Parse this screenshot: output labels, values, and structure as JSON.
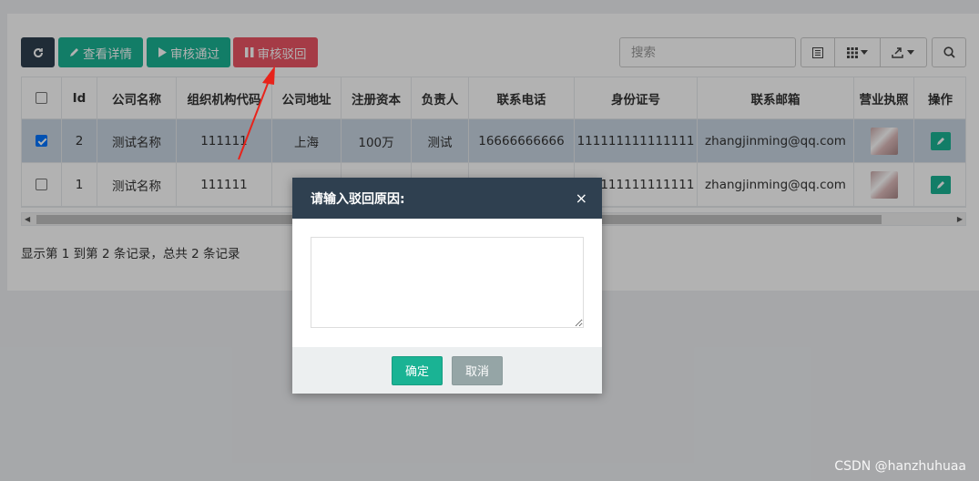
{
  "toolbar": {
    "detail_label": "查看详情",
    "approve_label": "审核通过",
    "reject_label": "审核驳回",
    "search_placeholder": "搜索"
  },
  "table": {
    "headers": [
      "Id",
      "公司名称",
      "组织机构代码",
      "公司地址",
      "注册资本",
      "负责人",
      "联系电话",
      "身份证号",
      "联系邮箱",
      "营业执照",
      "操作"
    ],
    "rows": [
      {
        "checked": true,
        "id": "2",
        "name": "测试名称",
        "org_code": "111111",
        "address": "上海",
        "capital": "100万",
        "owner": "测试",
        "phone": "16666666666",
        "id_card": "111111111111111",
        "email": "zhangjinming@qq.com"
      },
      {
        "checked": false,
        "id": "1",
        "name": "测试名称",
        "org_code": "111111",
        "address": "",
        "capital": "",
        "owner": "",
        "phone": "",
        "id_card": "111111111111111",
        "email": "zhangjinming@qq.com"
      }
    ]
  },
  "pager": {
    "text": "显示第 1 到第 2 条记录，总共 2 条记录"
  },
  "modal": {
    "title": "请输入驳回原因:",
    "close": "×",
    "textarea_value": "",
    "confirm_label": "确定",
    "cancel_label": "取消"
  },
  "watermark": "CSDN @hanzhuhuaa",
  "colors": {
    "dark": "#2f4050",
    "primary": "#1ab394",
    "danger": "#ed5565",
    "selected_row": "#c9d6e3"
  }
}
